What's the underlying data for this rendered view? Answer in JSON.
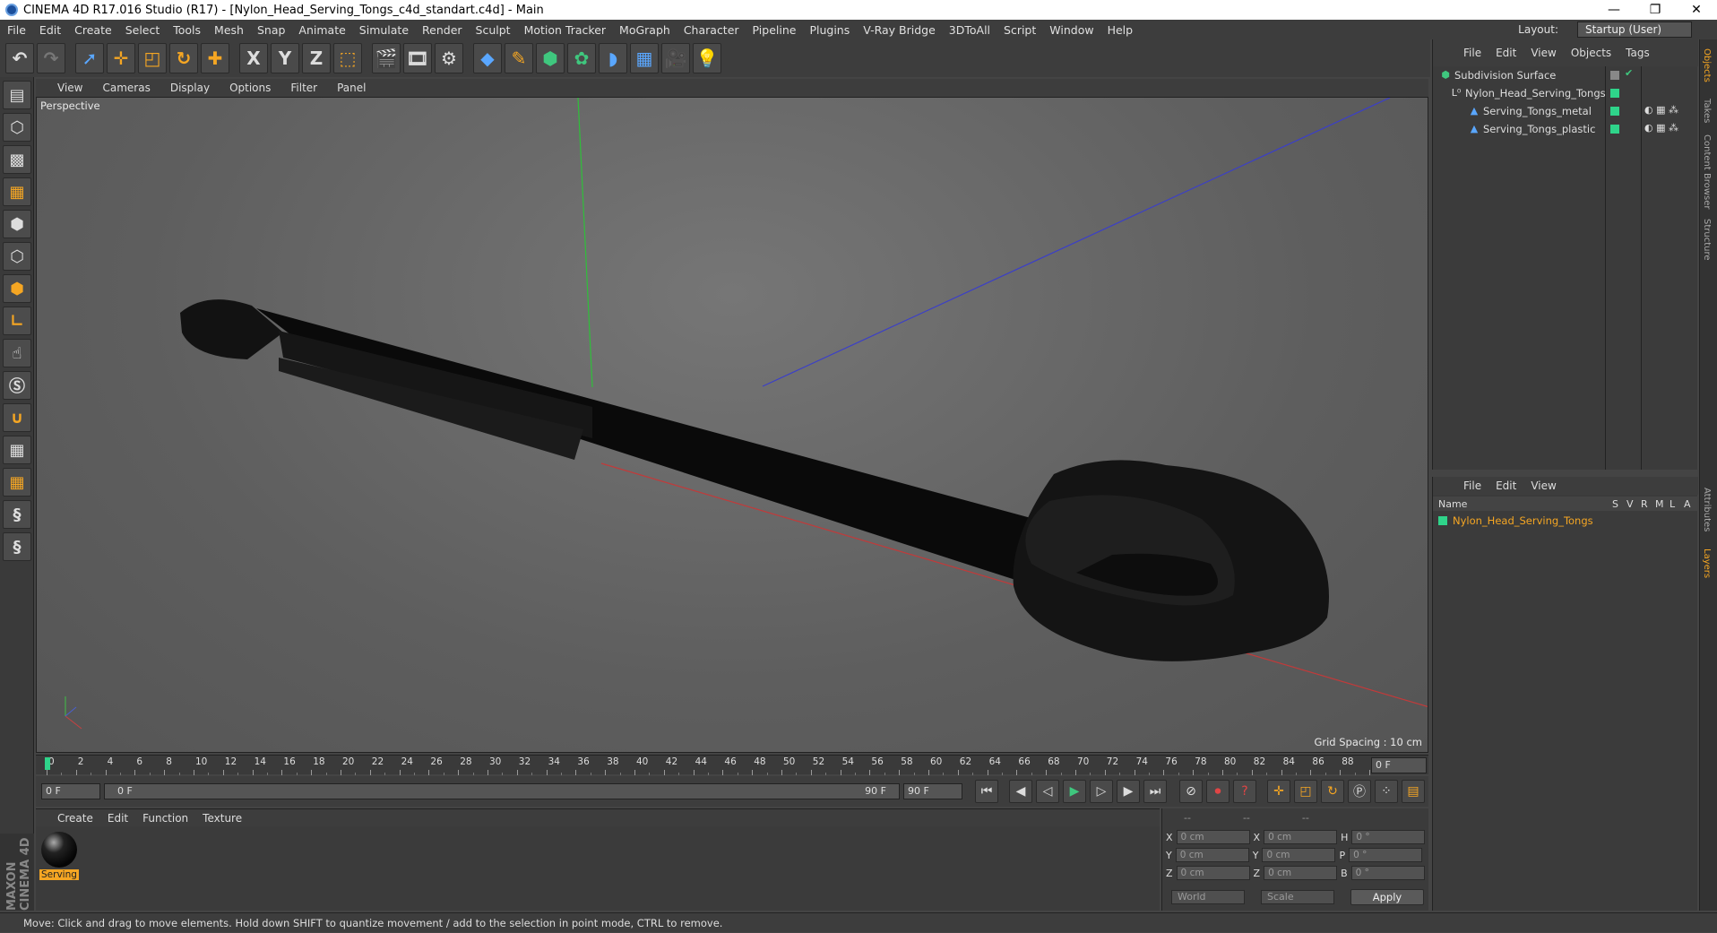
{
  "titlebar": {
    "title": "CINEMA 4D R17.016 Studio (R17) - [Nylon_Head_Serving_Tongs_c4d_standart.c4d] - Main",
    "min": "—",
    "max": "❐",
    "close": "✕"
  },
  "menubar": {
    "items": [
      "File",
      "Edit",
      "Create",
      "Select",
      "Tools",
      "Mesh",
      "Snap",
      "Animate",
      "Simulate",
      "Render",
      "Sculpt",
      "Motion Tracker",
      "MoGraph",
      "Character",
      "Pipeline",
      "Plugins",
      "V-Ray Bridge",
      "3DToAll",
      "Script",
      "Window",
      "Help"
    ],
    "layout_label": "Layout:",
    "layout_value": "Startup (User)"
  },
  "toolbar": {
    "icons": [
      "undo-icon",
      "redo-icon",
      "select-arrow-icon",
      "move-icon",
      "scale-icon",
      "rotate-icon",
      "transform-icon",
      "x-axis-icon",
      "y-axis-icon",
      "z-axis-icon",
      "coordinate-system-icon",
      "render-view-icon",
      "render-picture-viewer-icon",
      "edit-render-settings-icon",
      "cube-icon",
      "pen-icon",
      "subdivision-icon",
      "array-icon",
      "deformer-icon",
      "floor-icon",
      "camera-icon",
      "light-icon"
    ],
    "axis_labels": [
      "X",
      "Y",
      "Z"
    ]
  },
  "viewport": {
    "menu": [
      "View",
      "Cameras",
      "Display",
      "Options",
      "Filter",
      "Panel"
    ],
    "label": "Perspective",
    "grid_spacing": "Grid Spacing : 10 cm"
  },
  "timeline": {
    "ticks": [
      "0",
      "2",
      "4",
      "6",
      "8",
      "10",
      "12",
      "14",
      "16",
      "18",
      "20",
      "22",
      "24",
      "26",
      "28",
      "30",
      "32",
      "34",
      "36",
      "38",
      "40",
      "42",
      "44",
      "46",
      "48",
      "50",
      "52",
      "54",
      "56",
      "58",
      "60",
      "62",
      "64",
      "66",
      "68",
      "70",
      "72",
      "74",
      "76",
      "78",
      "80",
      "82",
      "84",
      "86",
      "88",
      "90"
    ],
    "current_frame": "0 F"
  },
  "transport": {
    "start": "0 F",
    "range_start": "0 F",
    "range_end": "90 F",
    "end": "90 F"
  },
  "materials": {
    "menu": [
      "Create",
      "Edit",
      "Function",
      "Texture"
    ],
    "items": [
      {
        "label": "Serving"
      }
    ]
  },
  "coords": {
    "header": [
      "--",
      "--",
      "--"
    ],
    "rows": [
      {
        "a": "X",
        "av": "0 cm",
        "b": "X",
        "bv": "0 cm",
        "c": "H",
        "cv": "0 °"
      },
      {
        "a": "Y",
        "av": "0 cm",
        "b": "Y",
        "bv": "0 cm",
        "c": "P",
        "cv": "0 °"
      },
      {
        "a": "Z",
        "av": "0 cm",
        "b": "Z",
        "bv": "0 cm",
        "c": "B",
        "cv": "0 °"
      }
    ],
    "world": "World",
    "scale": "Scale",
    "apply": "Apply"
  },
  "objects": {
    "menu": [
      "File",
      "Edit",
      "View",
      "Objects",
      "Tags"
    ],
    "tree": [
      "Subdivision Surface",
      "Nylon_Head_Serving_Tongs",
      "Serving_Tongs_metal",
      "Serving_Tongs_plastic"
    ]
  },
  "layers": {
    "menu": [
      "File",
      "Edit",
      "View"
    ],
    "cols": [
      "Name",
      "S",
      "V",
      "R",
      "M",
      "L",
      "A"
    ],
    "row": "Nylon_Head_Serving_Tongs"
  },
  "right_tabs": [
    "Objects",
    "Takes",
    "Content Browser",
    "Structure",
    "Attributes",
    "Layers"
  ],
  "status": "Move: Click and drag to move elements. Hold down SHIFT to quantize movement / add to the selection in point mode, CTRL to remove.",
  "brand": "MAXON CINEMA 4D",
  "colors": {
    "accent": "#f5a623",
    "layer_green": "#2fd48a"
  }
}
